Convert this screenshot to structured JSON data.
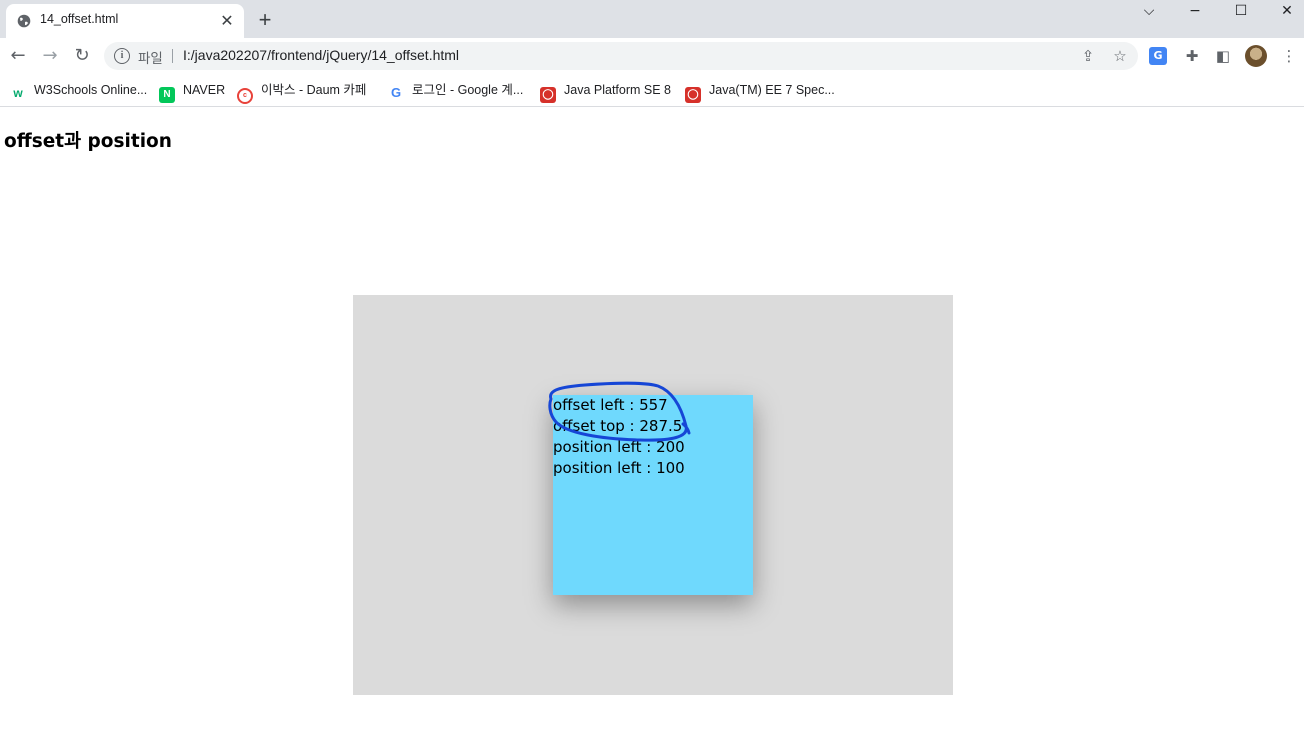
{
  "browser": {
    "tab": {
      "title": "14_offset.html"
    },
    "address_bar": {
      "scheme_label": "파일",
      "url": "I:/java202207/frontend/jQuery/14_offset.html"
    },
    "bookmarks": [
      {
        "label": "W3Schools Online...",
        "icon": "w3schools-icon"
      },
      {
        "label": "NAVER",
        "icon": "naver-icon"
      },
      {
        "label": "이박스 - Daum 카페",
        "icon": "daum-cafe-icon"
      },
      {
        "label": "로그인 - Google 계...",
        "icon": "google-icon"
      },
      {
        "label": "Java Platform SE 8",
        "icon": "oracle-icon"
      },
      {
        "label": "Java(TM) EE 7 Spec...",
        "icon": "oracle-icon"
      }
    ]
  },
  "page": {
    "heading": "offset과 position",
    "readouts": [
      "offset left : 557",
      "offset top : 287.5",
      "position left : 200",
      "position left : 100"
    ]
  },
  "colors": {
    "outer_box": "#dbdbdb",
    "inner_box": "#6fd9fd",
    "annotation": "#1646d6"
  }
}
